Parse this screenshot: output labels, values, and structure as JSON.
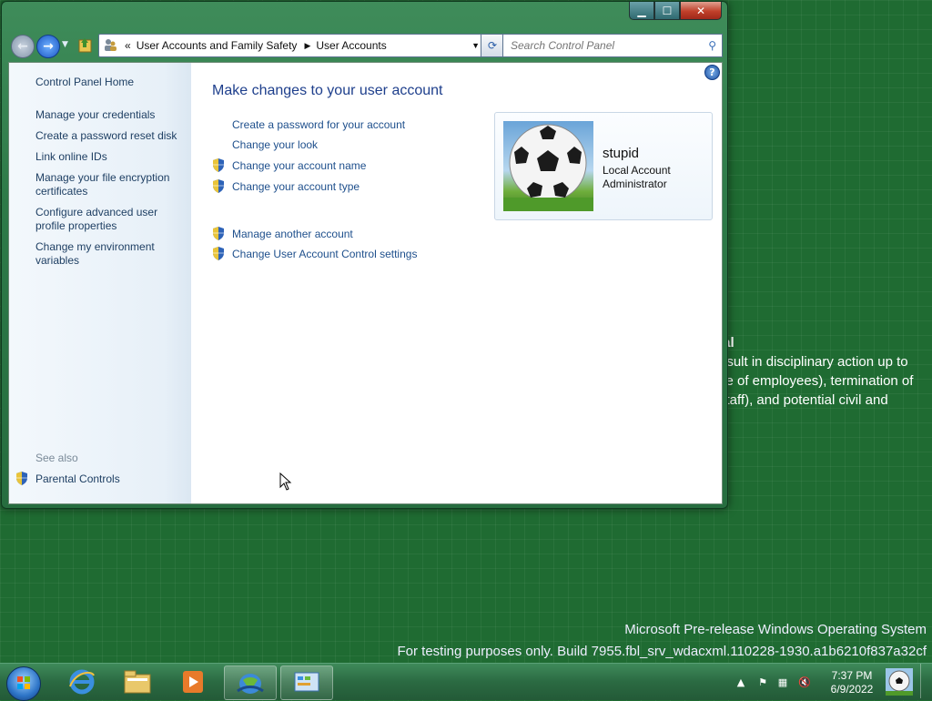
{
  "window": {
    "caption_buttons": {
      "minimize": "▁",
      "maximize": "☐",
      "close": "✕"
    }
  },
  "navigation": {
    "back_icon": "back-arrow-icon",
    "forward_icon": "forward-arrow-icon",
    "address": {
      "prefix": "«",
      "segments": [
        "User Accounts and Family Safety",
        "User Accounts"
      ]
    },
    "search_placeholder": "Search Control Panel"
  },
  "sidebar": {
    "home": "Control Panel Home",
    "links": [
      "Manage your credentials",
      "Create a password reset disk",
      "Link online IDs",
      "Manage your file encryption certificates",
      "Configure advanced user profile properties",
      "Change my environment variables"
    ],
    "see_also_label": "See also",
    "see_also_links": [
      "Parental Controls"
    ]
  },
  "main": {
    "title": "Make changes to your user account",
    "tasks": [
      {
        "label": "Create a password for your account",
        "shield": false
      },
      {
        "label": "Change your look",
        "shield": false
      },
      {
        "label": "Change your account name",
        "shield": true
      },
      {
        "label": "Change your account type",
        "shield": true
      },
      {
        "label": "Manage another account",
        "shield": true
      },
      {
        "label": "Change User Account Control settings",
        "shield": true
      }
    ]
  },
  "account": {
    "name": "stupid",
    "type": "Local Account",
    "role": "Administrator",
    "avatar_icon": "soccer-ball-picture"
  },
  "desktop": {
    "background_text": [
      "ial",
      "esult in disciplinary action up to",
      "se of employees), termination of",
      "staff), and potential civil and"
    ],
    "watermark": [
      "Microsoft Pre-release Windows Operating System",
      "For testing purposes only. Build 7955.fbl_srv_wdacxml.110228-1930.a1b6210f837a32cf"
    ]
  },
  "taskbar": {
    "pinned": [
      "internet-explorer-icon",
      "windows-explorer-icon",
      "media-player-icon",
      "network-globe-icon",
      "control-panel-icon"
    ],
    "clock_time": "7:37 PM",
    "clock_date": "6/9/2022"
  },
  "colors": {
    "desktop": "#1f6b32",
    "link": "#1e4f8c",
    "title": "#1e3f8c"
  }
}
